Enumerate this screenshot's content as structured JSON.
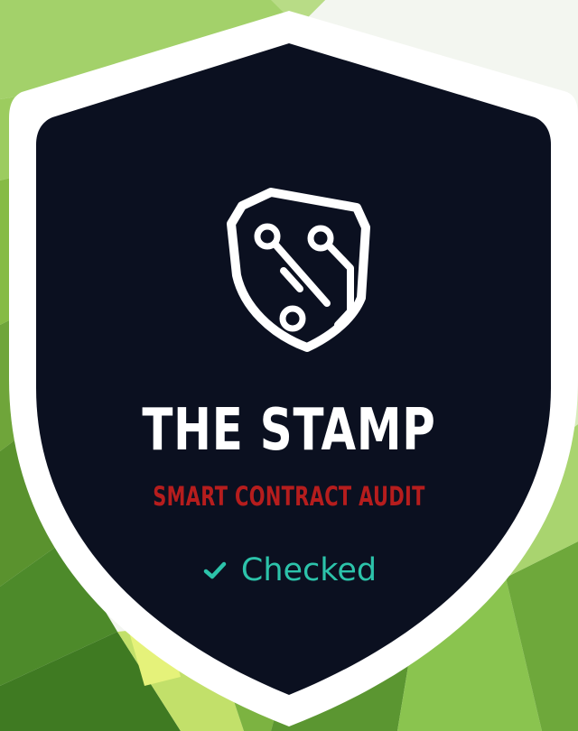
{
  "badge": {
    "icon": "shield-circuit-icon",
    "title": "THE STAMP",
    "subtitle": "SMART CONTRACT AUDIT",
    "status": {
      "icon": "check-icon",
      "label": "Checked"
    }
  },
  "colors": {
    "badge_background": "#0b1020",
    "badge_border": "#ffffff",
    "title": "#ffffff",
    "subtitle": "#b61d1d",
    "status": "#2cc3aa",
    "background_green": "#8cc84b",
    "background_light": "#f3f6f0"
  }
}
